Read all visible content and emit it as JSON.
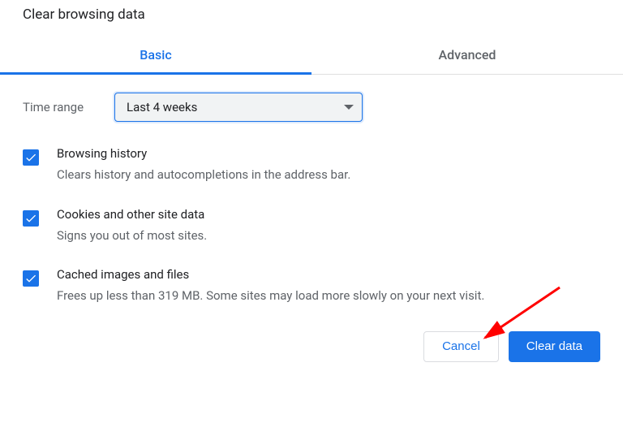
{
  "title": "Clear browsing data",
  "tabs": {
    "basic": "Basic",
    "advanced": "Advanced"
  },
  "timeRange": {
    "label": "Time range",
    "selected": "Last 4 weeks"
  },
  "options": {
    "browsing": {
      "title": "Browsing history",
      "desc": "Clears history and autocompletions in the address bar."
    },
    "cookies": {
      "title": "Cookies and other site data",
      "desc": "Signs you out of most sites."
    },
    "cache": {
      "title": "Cached images and files",
      "desc": "Frees up less than 319 MB. Some sites may load more slowly on your next visit."
    }
  },
  "buttons": {
    "cancel": "Cancel",
    "clear": "Clear data"
  }
}
